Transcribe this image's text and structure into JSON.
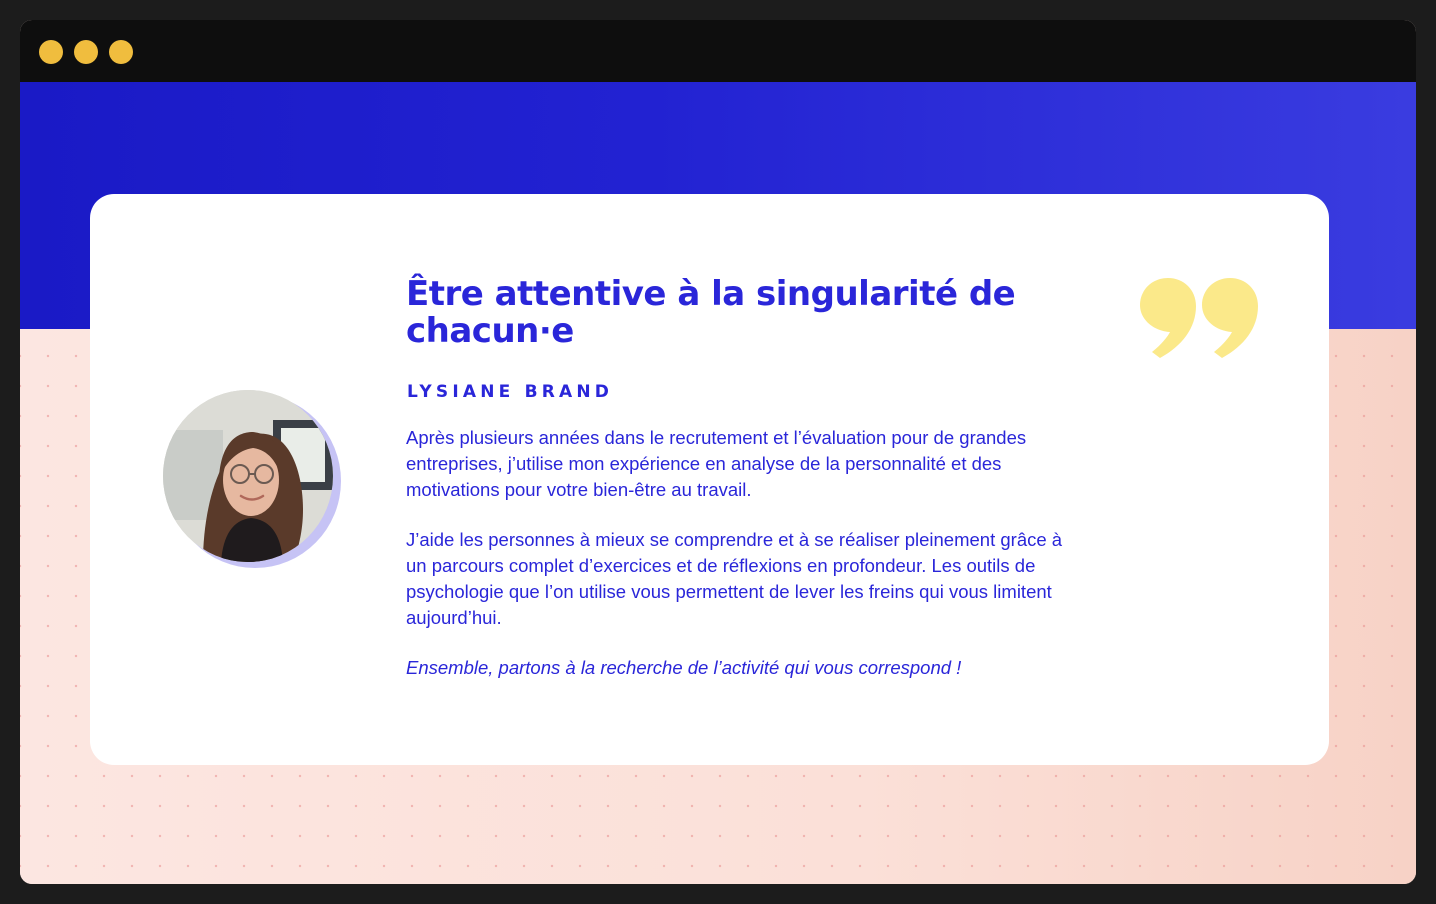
{
  "window": {
    "controls": [
      "close",
      "minimize",
      "maximize"
    ],
    "control_color": "#f0bd3e"
  },
  "colors": {
    "accent": "#2a26d9",
    "hero": "#1a1ac6",
    "quote": "#fbe98a",
    "avatar_ring": "#c6c3f5"
  },
  "testimonial": {
    "headline": "Être attentive à la singularité de chacun·e",
    "author": "LYSIANE BRAND",
    "paragraph_1": "Après plusieurs années dans le recrutement et l’évaluation pour de grandes entreprises,  j’utilise mon expérience en analyse de la personnalité et des motivations pour votre bien-être au travail.",
    "paragraph_2": "J’aide les personnes à mieux se comprendre et à se réaliser pleinement grâce à un parcours complet d’exercices et de réflexions en profondeur. Les outils de psychologie que l’on utilise vous permettent de lever les freins qui vous limitent aujourd’hui.",
    "paragraph_3": "Ensemble, partons à la recherche de l’activité qui vous correspond !",
    "quote_icon": "closing-quote-icon",
    "avatar_icon": "portrait-photo"
  }
}
